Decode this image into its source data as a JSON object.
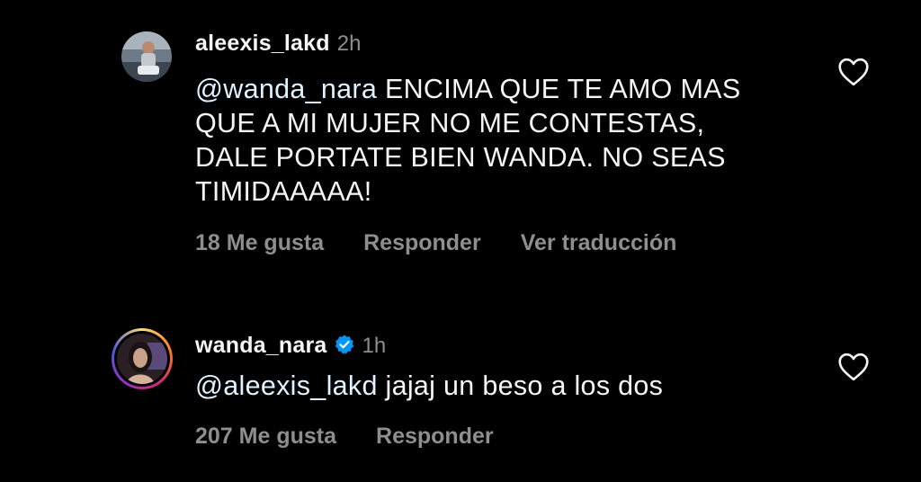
{
  "comments": [
    {
      "username": "aleexis_lakd",
      "time": "2h",
      "mention": "@wanda_nara",
      "text": "ENCIMA QUE TE AMO MAS QUE A MI MUJER NO ME CONTESTAS, DALE PORTATE BIEN WANDA. NO SEAS TIMIDAAAAA!",
      "likes": "18 Me gusta",
      "reply": "Responder",
      "translate": "Ver traducción",
      "avatar_icon": "user-photo"
    },
    {
      "username": "wanda_nara",
      "verified_icon": "verified-badge-icon",
      "time": "1h",
      "mention": "@aleexis_lakd",
      "text": "jajaj un beso a los dos",
      "likes": "207 Me gusta",
      "reply": "Responder",
      "avatar_icon": "user-photo-story-ring"
    }
  ],
  "colors": {
    "background": "#000000",
    "text": "#f5f5f5",
    "muted": "#8e8e8e",
    "mention": "#e0f1ff",
    "verified": "#0095f6"
  }
}
